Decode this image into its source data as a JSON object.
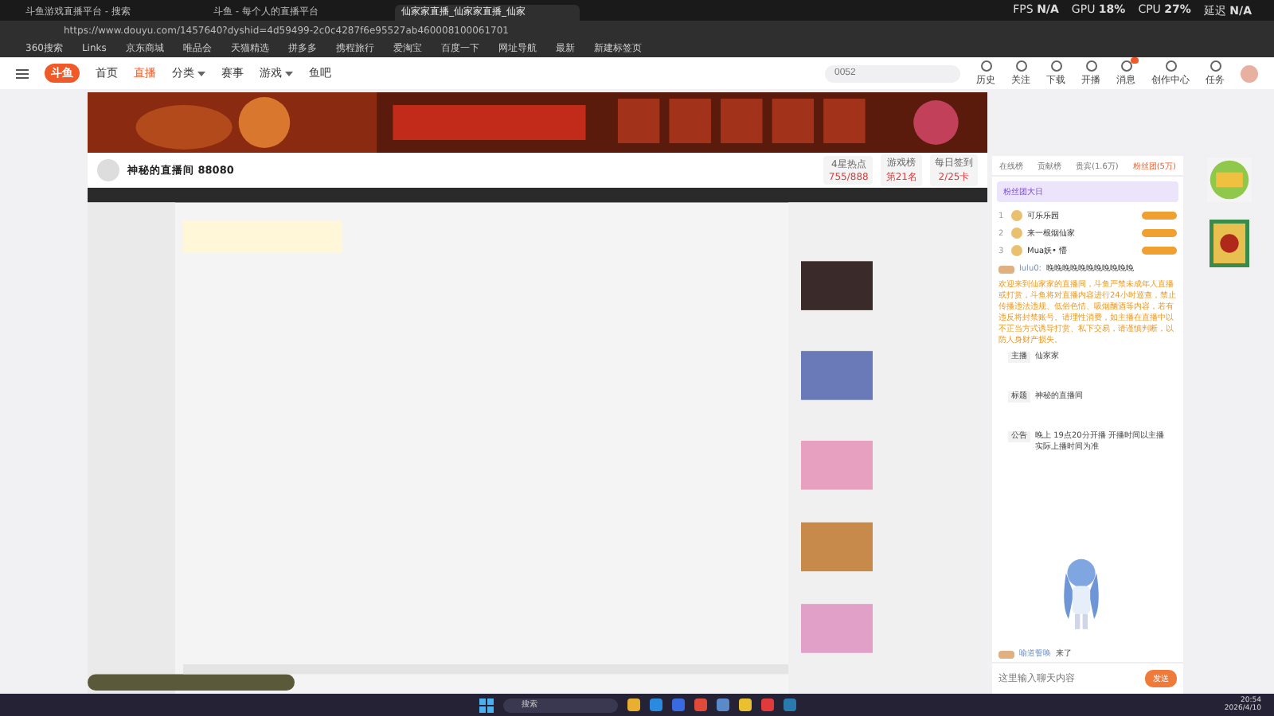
{
  "browser": {
    "tabs": [
      {
        "title": "斗鱼游戏直播平台 - 搜索",
        "selected": false
      },
      {
        "title": "斗鱼 - 每个人的直播平台",
        "selected": false
      },
      {
        "title": "仙家家直播_仙家家直播_仙家",
        "selected": true
      }
    ],
    "address": "https://www.douyu.com/1457640?dyshid=4d59499-2c0c4287f6e95527ab460008100061701",
    "bookmarks": [
      "360搜索",
      "Links",
      "京东商城",
      "唯品会",
      "天猫精选",
      "拼多多",
      "携程旅行",
      "爱淘宝",
      "百度一下",
      "网址导航",
      "最新",
      "新建标签页"
    ]
  },
  "overlay": [
    {
      "label": "FPS",
      "value": "N/A"
    },
    {
      "label": "GPU",
      "value": "18%"
    },
    {
      "label": "CPU",
      "value": "27%"
    },
    {
      "label": "延迟",
      "value": "N/A"
    }
  ],
  "site": {
    "logo": "斗鱼",
    "nav": [
      {
        "label": "首页",
        "selected": false,
        "dropdown": false
      },
      {
        "label": "直播",
        "selected": true,
        "dropdown": false
      },
      {
        "label": "分类",
        "selected": false,
        "dropdown": true
      },
      {
        "label": "赛事",
        "selected": false,
        "dropdown": false
      },
      {
        "label": "游戏",
        "selected": false,
        "dropdown": true
      },
      {
        "label": "鱼吧",
        "selected": false,
        "dropdown": false
      }
    ],
    "search": {
      "placeholder": "0052"
    },
    "tools": [
      {
        "label": "历史",
        "badge": false
      },
      {
        "label": "关注",
        "badge": false
      },
      {
        "label": "下载",
        "badge": false
      },
      {
        "label": "开播",
        "badge": false
      },
      {
        "label": "消息",
        "badge": true
      },
      {
        "label": "创作中心",
        "badge": false
      },
      {
        "label": "任务",
        "badge": false
      }
    ]
  },
  "room": {
    "name": "神秘的直播间 88080",
    "stats": [
      {
        "label": "4星热点",
        "value": "755/888"
      },
      {
        "label": "游戏榜",
        "value": "第21名"
      },
      {
        "label": "每日签到",
        "value": "2/25卡"
      }
    ]
  },
  "chat": {
    "tabs": [
      {
        "label": "在线榜",
        "selected": false
      },
      {
        "label": "贡献榜",
        "selected": false
      },
      {
        "label": "贵宾(1.6万)",
        "selected": false
      },
      {
        "label": "粉丝团(5万)",
        "selected": true
      }
    ],
    "ranking_title": "粉丝团大日",
    "ranking": [
      {
        "rank": "1",
        "name": "可乐乐园"
      },
      {
        "rank": "2",
        "name": "来一根烟仙家"
      },
      {
        "rank": "3",
        "name": "Mua妖• 懵"
      }
    ],
    "messages": [
      {
        "kind": "user",
        "name": "lulu0:",
        "text": "晚晚晚晚晚晚晚晚晚晚晚"
      },
      {
        "kind": "notice",
        "text": "欢迎来到仙家家的直播间，斗鱼严禁未成年人直播或打赏，斗鱼将对直播内容进行24小时巡查，禁止传播违法违规、低俗色情、吸烟酗酒等内容，若有违反将封禁账号。请理性消费，如主播在直播中以不正当方式诱导打赏、私下交易，请谨慎判断，以防人身财产损失。"
      },
      {
        "kind": "info",
        "name": "主播",
        "text": "仙家家"
      },
      {
        "kind": "info",
        "name": "标题",
        "text": "神秘的直播间"
      },
      {
        "kind": "info",
        "name": "公告",
        "text": "晚上 19点20分开播 开播时间以主播实际上播时间为准"
      }
    ],
    "last_message": {
      "name": "喻道誓唤",
      "text": "来了"
    },
    "input": {
      "placeholder": "这里输入聊天内容",
      "send": "发送"
    }
  },
  "taskbar": {
    "search": "搜索",
    "time": "20:54",
    "date": "2026/4/10"
  }
}
